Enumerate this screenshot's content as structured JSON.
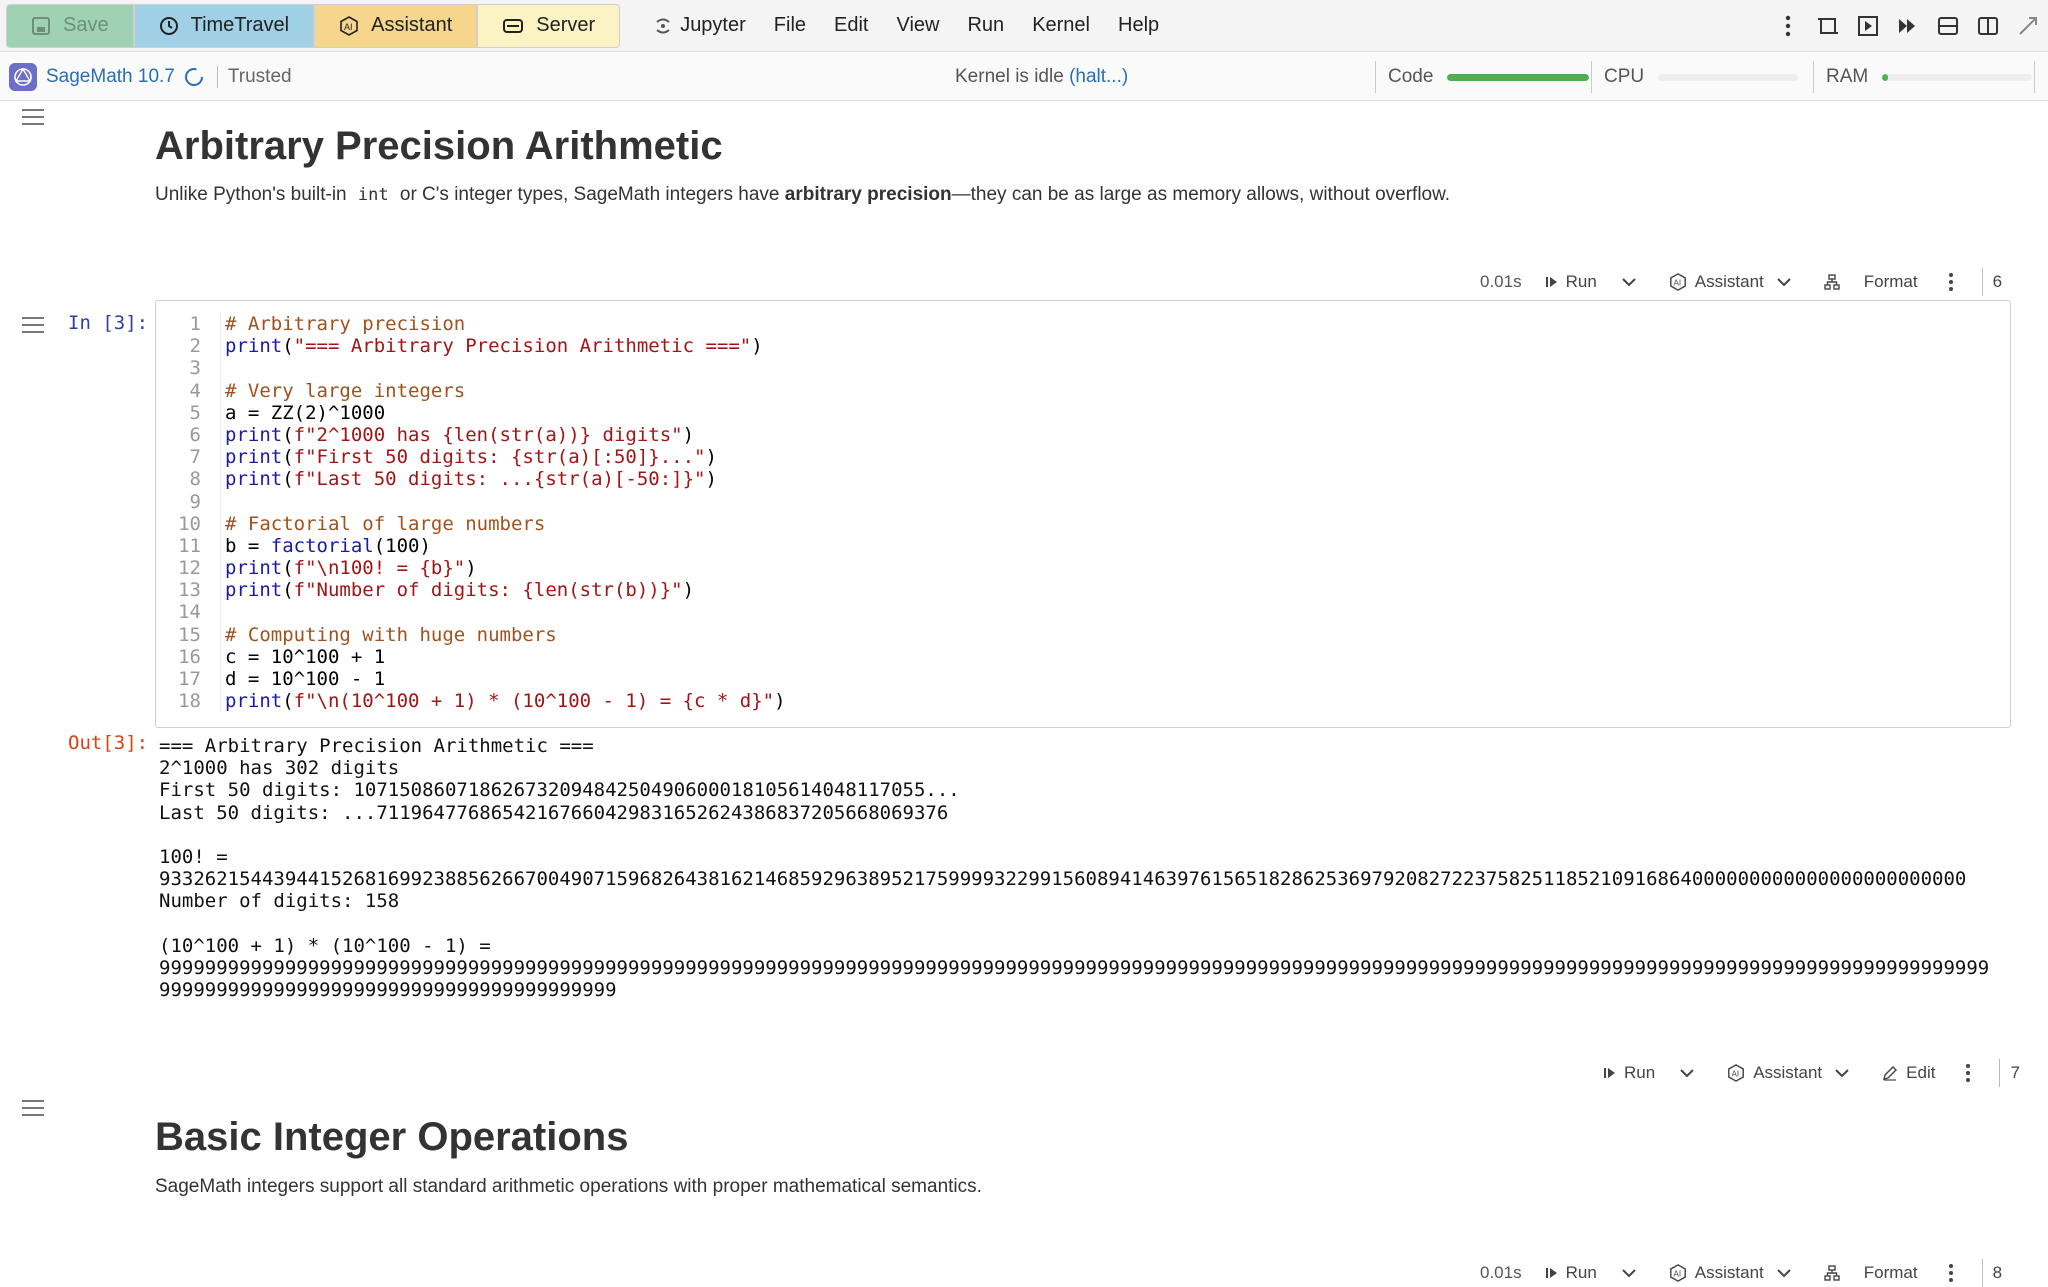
{
  "toolbar": {
    "save": "Save",
    "timetravel": "TimeTravel",
    "assistant": "Assistant",
    "server": "Server",
    "menu": [
      "Jupyter",
      "File",
      "Edit",
      "View",
      "Run",
      "Kernel",
      "Help"
    ]
  },
  "status": {
    "kernel_name": "SageMath 10.7",
    "trusted": "Trusted",
    "kernel_state": "Kernel is idle",
    "halt": "(halt...)",
    "code_label": "Code",
    "cpu_label": "CPU",
    "ram_label": "RAM",
    "code_level": 1.0,
    "cpu_level": 0.0,
    "ram_level": 0.04
  },
  "md1": {
    "title": "Arbitrary Precision Arithmetic",
    "text_pre": "Unlike Python's built-in ",
    "text_code": "int",
    "text_mid": " or C's integer types, SageMath integers have ",
    "text_bold": "arbitrary precision",
    "text_post": "—they can be as large as memory allows, without overflow."
  },
  "cell_toolbar_1": {
    "time": "0.01s",
    "run": "Run",
    "assistant": "Assistant",
    "format": "Format",
    "index": "6"
  },
  "cell": {
    "in_prompt": "In [3]:",
    "out_prompt": "Out[3]:",
    "line_numbers": [
      "1",
      "2",
      "3",
      "4",
      "5",
      "6",
      "7",
      "8",
      "9",
      "10",
      "11",
      "12",
      "13",
      "14",
      "15",
      "16",
      "17",
      "18"
    ],
    "code": [
      "# Arbitrary precision",
      "print(\"=== Arbitrary Precision Arithmetic ===\")",
      "",
      "# Very large integers",
      "a = ZZ(2)^1000",
      "print(f\"2^1000 has {len(str(a))} digits\")",
      "print(f\"First 50 digits: {str(a)[:50]}...\")",
      "print(f\"Last 50 digits: ...{str(a)[-50:]}\")",
      "",
      "# Factorial of large numbers",
      "b = factorial(100)",
      "print(f\"\\n100! = {b}\")",
      "print(f\"Number of digits: {len(str(b))}\")",
      "",
      "# Computing with huge numbers",
      "c = 10^100 + 1",
      "d = 10^100 - 1",
      "print(f\"\\n(10^100 + 1) * (10^100 - 1) = {c * d}\")"
    ],
    "output": [
      "=== Arbitrary Precision Arithmetic ===",
      "2^1000 has 302 digits",
      "First 50 digits: 10715086071862673209484250490600018105614048117055...",
      "Last 50 digits: ...71196477686542167660429831652624386837205668069376",
      "",
      "100! =",
      "93326215443944152681699238856266700490715968264381621468592963895217599993229915608941463976156518286253697920827223758251185210916864000000000000000000000000",
      "Number of digits: 158",
      "",
      "(10^100 + 1) * (10^100 - 1) =",
      "9999999999999999999999999999999999999999999999999999999999999999999999999999999999999999999999999999999999999999999999999999999999999999999999999999999999999999",
      "9999999999999999999999999999999999999999"
    ]
  },
  "cell_toolbar_2": {
    "run": "Run",
    "assistant": "Assistant",
    "edit": "Edit",
    "index": "7"
  },
  "md2": {
    "title": "Basic Integer Operations",
    "text": "SageMath integers support all standard arithmetic operations with proper mathematical semantics."
  },
  "cell_toolbar_3": {
    "time": "0.01s",
    "run": "Run",
    "assistant": "Assistant",
    "format": "Format",
    "index": "8"
  },
  "colors": {
    "accent": "#2a6fb5",
    "save_bg": "#9fd2b2",
    "timetravel_bg": "#9fd0e6",
    "assistant_bg": "#f6d58c",
    "server_bg": "#fbf3c3",
    "meter": "#4caf50"
  }
}
